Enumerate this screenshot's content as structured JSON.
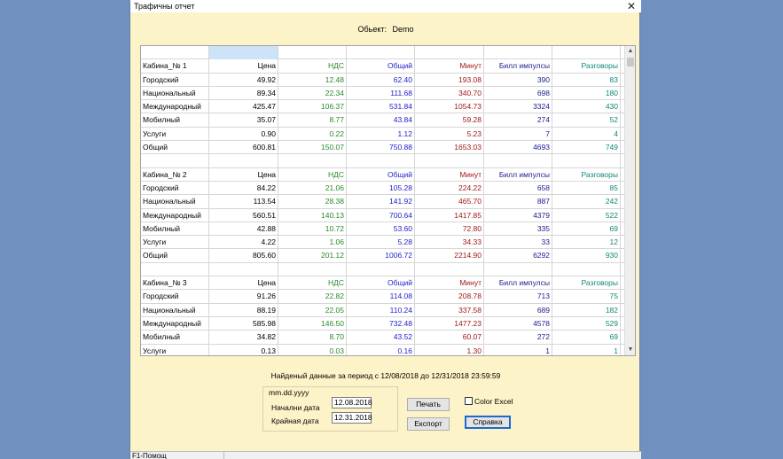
{
  "window": {
    "title": "Трафичны отчет",
    "close_glyph": "✕"
  },
  "object": {
    "label": "Обьект:",
    "value": "Demo"
  },
  "grid": {
    "rows": [
      {
        "type": "blank",
        "cells": [
          "",
          "",
          "",
          "",
          "",
          "",
          ""
        ]
      },
      {
        "type": "header",
        "cells": [
          "Кабина_№  1",
          "Цена",
          "НДС",
          "Общий",
          "Минут",
          "Билл импулсы",
          "Разговоры"
        ]
      },
      {
        "type": "data",
        "cells": [
          "Городский",
          "49.92",
          "12.48",
          "62.40",
          "193.08",
          "390",
          "83"
        ]
      },
      {
        "type": "data",
        "cells": [
          "Национальный",
          "89.34",
          "22.34",
          "111.68",
          "340.70",
          "698",
          "180"
        ]
      },
      {
        "type": "data",
        "cells": [
          "Международный",
          "425.47",
          "106.37",
          "531.84",
          "1054.73",
          "3324",
          "430"
        ]
      },
      {
        "type": "data",
        "cells": [
          "Мобилный",
          "35.07",
          "8.77",
          "43.84",
          "59.28",
          "274",
          "52"
        ]
      },
      {
        "type": "data",
        "cells": [
          "Услуги",
          "0.90",
          "0.22",
          "1.12",
          "5.23",
          "7",
          "4"
        ]
      },
      {
        "type": "data",
        "cells": [
          "Общий",
          "600.81",
          "150.07",
          "750.88",
          "1653.03",
          "4693",
          "749"
        ]
      },
      {
        "type": "blank",
        "cells": [
          "",
          "",
          "",
          "",
          "",
          "",
          ""
        ]
      },
      {
        "type": "header",
        "cells": [
          "Кабина_№  2",
          "Цена",
          "НДС",
          "Общий",
          "Минут",
          "Билл импулсы",
          "Разговоры"
        ]
      },
      {
        "type": "data",
        "cells": [
          "Городский",
          "84.22",
          "21.06",
          "105.28",
          "224.22",
          "658",
          "85"
        ]
      },
      {
        "type": "data",
        "cells": [
          "Национальный",
          "113.54",
          "28.38",
          "141.92",
          "465.70",
          "887",
          "242"
        ]
      },
      {
        "type": "data",
        "cells": [
          "Международный",
          "560.51",
          "140.13",
          "700.64",
          "1417.85",
          "4379",
          "522"
        ]
      },
      {
        "type": "data",
        "cells": [
          "Мобилный",
          "42.88",
          "10.72",
          "53.60",
          "72.80",
          "335",
          "69"
        ]
      },
      {
        "type": "data",
        "cells": [
          "Услуги",
          "4.22",
          "1.06",
          "5.28",
          "34.33",
          "33",
          "12"
        ]
      },
      {
        "type": "data",
        "cells": [
          "Общий",
          "805.60",
          "201.12",
          "1006.72",
          "2214.90",
          "6292",
          "930"
        ]
      },
      {
        "type": "blank",
        "cells": [
          "",
          "",
          "",
          "",
          "",
          "",
          ""
        ]
      },
      {
        "type": "header",
        "cells": [
          "Кабина_№  3",
          "Цена",
          "НДС",
          "Общий",
          "Минут",
          "Билл импулсы",
          "Разговоры"
        ]
      },
      {
        "type": "data",
        "cells": [
          "Городский",
          "91.26",
          "22.82",
          "114.08",
          "208.78",
          "713",
          "75"
        ]
      },
      {
        "type": "data",
        "cells": [
          "Национальный",
          "88.19",
          "22.05",
          "110.24",
          "337.58",
          "689",
          "182"
        ]
      },
      {
        "type": "data",
        "cells": [
          "Международный",
          "585.98",
          "146.50",
          "732.48",
          "1477.23",
          "4578",
          "529"
        ]
      },
      {
        "type": "data",
        "cells": [
          "Мобилный",
          "34.82",
          "8.70",
          "43.52",
          "60.07",
          "272",
          "69"
        ]
      },
      {
        "type": "data",
        "cells": [
          "Услуги",
          "0.13",
          "0.03",
          "0.16",
          "1.30",
          "1",
          "1"
        ]
      }
    ]
  },
  "scrollbar": {
    "up_icon": "up-arrow-icon",
    "down_icon": "down-arrow-icon"
  },
  "period": {
    "text": "Найденый данные за период с 12/08/2018  до 12/31/2018 23:59:59"
  },
  "dates": {
    "legend": "mm.dd.yyyy",
    "start_label": "Начални дата",
    "start_value": "12.08.2018",
    "end_label": "Крайная дата",
    "end_value": "12.31.2018"
  },
  "buttons": {
    "print": "Печать",
    "export": "Експорт",
    "help": "Справка"
  },
  "color_excel": {
    "label": "Color Excel",
    "checked": false
  },
  "statusbar": {
    "text": "F1-Помощ"
  }
}
